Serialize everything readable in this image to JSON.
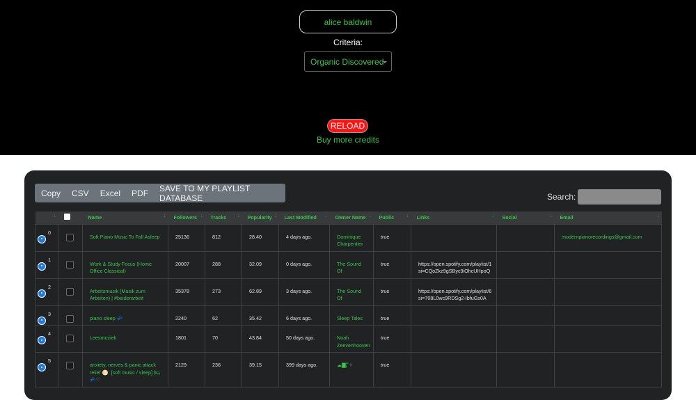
{
  "header": {
    "user_name": "alice baldwin",
    "criteria_label": "Criteria:",
    "criteria_value": "Organic Discovered",
    "reload_label": "RELOAD",
    "credits_link": "Buy more credits"
  },
  "toolbar": {
    "buttons": [
      "Copy",
      "CSV",
      "Excel",
      "PDF",
      "SAVE TO MY PLAYLIST DATABASE"
    ],
    "search_label": "Search:",
    "search_value": ""
  },
  "table": {
    "columns": [
      "",
      "",
      "Name",
      "Followers",
      "Tracks",
      "Popularity",
      "Last Modified",
      "Owner Name",
      "Public",
      "Links",
      "Social",
      "Email"
    ],
    "rows": [
      {
        "index": "0",
        "name": "Soft Piano Music To Fall Asleep",
        "followers": "25136",
        "tracks": "812",
        "popularity": "28.40",
        "last_modified": "4 days ago.",
        "owner": "Dominique Charpentier",
        "public": "true",
        "links": "",
        "social": "",
        "email": "modernpianorecordings@gmail.com"
      },
      {
        "index": "1",
        "name": "Work & Study Focus (Home Office Classical)",
        "followers": "20007",
        "tracks": "288",
        "popularity": "32.09",
        "last_modified": "0 days ago.",
        "owner": "The Sound Of",
        "public": "true",
        "links": "https://open.spotify.com/playlist/1 si=CQoZkz9gSByc9iOhcUHpoQ",
        "social": "",
        "email": ""
      },
      {
        "index": "2",
        "name": "Arbeitsmusik (Musik zum Arbeiten) | #beiderarbeit",
        "followers": "35378",
        "tracks": "273",
        "popularity": "62.89",
        "last_modified": "3 days ago.",
        "owner": "The Sound Of",
        "public": "true",
        "links": "https://open.spotify.com/playlist/6 si=708L0wc9RDSg2-IbfuGs0A",
        "social": "",
        "email": ""
      },
      {
        "index": "3",
        "name": "piano sleep 💤",
        "followers": "2240",
        "tracks": "62",
        "popularity": "35.42",
        "last_modified": "6 days ago.",
        "owner": "Sleep Tales",
        "public": "true",
        "links": "",
        "social": "",
        "email": ""
      },
      {
        "index": "4",
        "name": "Leesmuziek",
        "followers": "1801",
        "tracks": "70",
        "popularity": "43.84",
        "last_modified": "50 days ago.",
        "owner": "Noah Zeevenhooven",
        "public": "true",
        "links": "",
        "social": "",
        "email": ""
      },
      {
        "index": "5",
        "name": "anxiety, nerves & panic attack relief 🌕; [soft music / sleep] 🛏💤♡",
        "followers": "2129",
        "tracks": "236",
        "popularity": "39.15",
        "last_modified": "399 days ago.",
        "owner": "☁▇⸽˚✧",
        "public": "true",
        "links": "",
        "social": "",
        "email": ""
      }
    ]
  }
}
